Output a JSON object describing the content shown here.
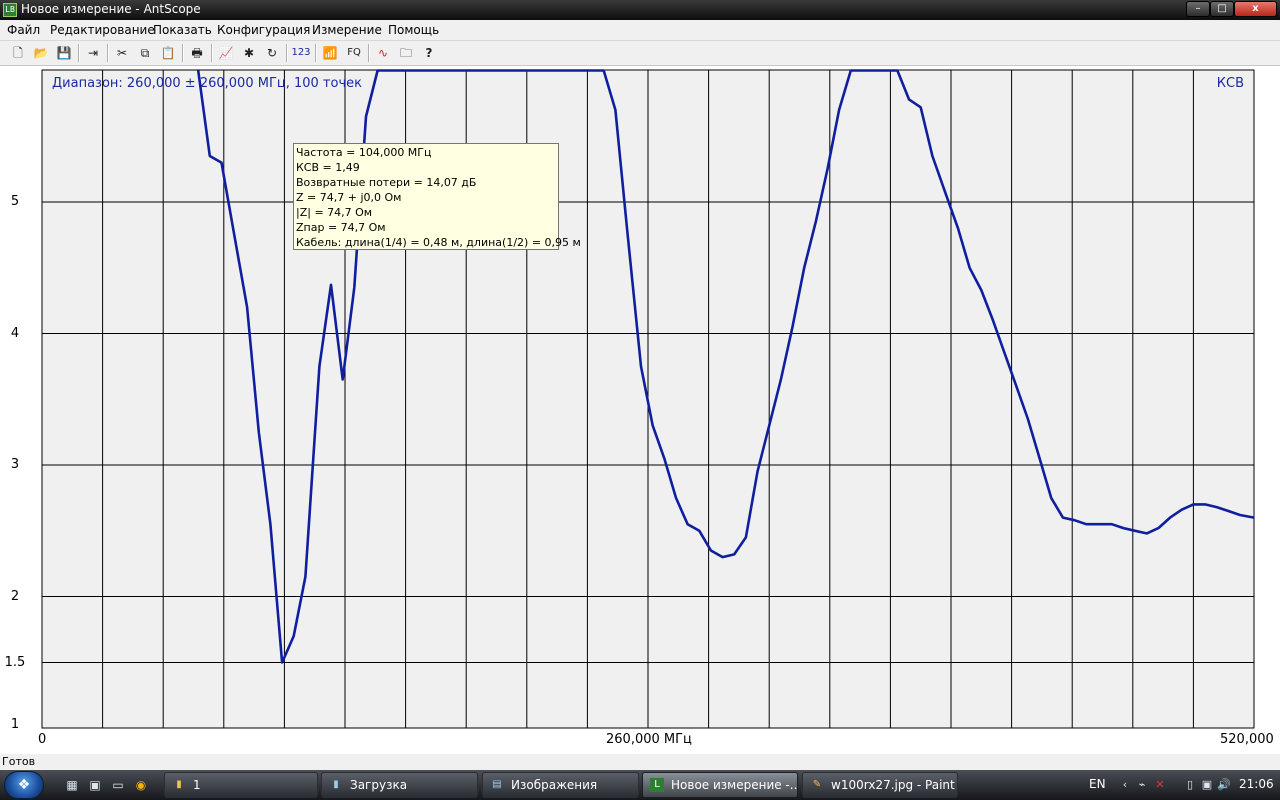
{
  "window": {
    "title": "Новое измерение - AntScope",
    "app_icon": "antscope-app-icon",
    "controls": {
      "minimize": "–",
      "maximize": "□",
      "close": "x"
    }
  },
  "menu": {
    "items": [
      "Файл",
      "Редактирование",
      "Показать",
      "Конфигурация",
      "Измерение",
      "Помощь"
    ]
  },
  "toolbar": {
    "buttons": [
      {
        "name": "new-icon",
        "glyph": "🗋"
      },
      {
        "name": "open-icon",
        "glyph": "📂"
      },
      {
        "name": "save-icon",
        "glyph": "💾"
      },
      {
        "name": "export-icon",
        "glyph": "⇥"
      },
      {
        "name": "cut-icon",
        "glyph": "✂"
      },
      {
        "name": "copy-icon",
        "glyph": "⧉"
      },
      {
        "name": "paste-icon",
        "glyph": "📋"
      },
      {
        "name": "print-icon",
        "glyph": "🖶"
      },
      {
        "name": "chart-icon",
        "glyph": "📈"
      },
      {
        "name": "markers-icon",
        "glyph": "✱"
      },
      {
        "name": "refresh-icon",
        "glyph": "↻"
      },
      {
        "name": "number-icon",
        "glyph": "123"
      },
      {
        "name": "antenna-icon",
        "glyph": "📶"
      },
      {
        "name": "frequency-icon",
        "glyph": "FQ"
      },
      {
        "name": "waves-icon",
        "glyph": "∿"
      },
      {
        "name": "open-folder-icon",
        "glyph": "🗀"
      },
      {
        "name": "help-icon",
        "glyph": "?"
      }
    ]
  },
  "chart_info": {
    "range_label": "Диапазон: 260,000 ± 260,000 МГц, 100 точек",
    "unit_label": "КСВ"
  },
  "chart_data": {
    "type": "line",
    "title": "",
    "xlabel": "",
    "ylabel": "КСВ",
    "x_tick_labels": [
      "0",
      "260,000 МГц",
      "520,000"
    ],
    "y_tick_labels": [
      "5",
      "4",
      "3",
      "2",
      "1.5",
      "1"
    ],
    "xlim": [
      0,
      520
    ],
    "grid": true,
    "series": [
      {
        "color": "#0f1f9e",
        "x": [
          67,
          72,
          77,
          82,
          88,
          93,
          98,
          103,
          108,
          113,
          119,
          124,
          129,
          134,
          139,
          144,
          149,
          154,
          160,
          165,
          170,
          175,
          181,
          185,
          191,
          196,
          201,
          206,
          211,
          216,
          221,
          226,
          231,
          236,
          241,
          246,
          251,
          257,
          262,
          267,
          272,
          277,
          282,
          287,
          292,
          297,
          302,
          307,
          312,
          317,
          322,
          327,
          332,
          337,
          342,
          347,
          352,
          357,
          362,
          367,
          372,
          377,
          382,
          388,
          393,
          398,
          403,
          408,
          413,
          418,
          423,
          428,
          433,
          438,
          443,
          448,
          453,
          459,
          464,
          469,
          474,
          479,
          484,
          489,
          494,
          499,
          504,
          509,
          514,
          520
        ],
        "y": [
          6.0,
          5.35,
          5.3,
          4.8,
          4.2,
          3.25,
          2.55,
          1.5,
          1.7,
          2.15,
          3.75,
          4.37,
          3.65,
          4.35,
          5.65,
          6.0,
          6.0,
          6.0,
          6.0,
          6.0,
          6.0,
          6.0,
          6.0,
          6.0,
          6.0,
          6.0,
          6.0,
          6.0,
          6.0,
          6.0,
          6.0,
          6.0,
          6.0,
          6.0,
          6.0,
          5.7,
          4.8,
          3.75,
          3.3,
          3.05,
          2.75,
          2.55,
          2.5,
          2.35,
          2.3,
          2.32,
          2.45,
          2.95,
          3.3,
          3.65,
          4.05,
          4.5,
          4.85,
          5.25,
          5.7,
          6.0,
          6.0,
          6.0,
          6.0,
          6.0,
          5.78,
          5.72,
          5.35,
          5.05,
          4.8,
          4.5,
          4.33,
          4.1,
          3.85,
          3.6,
          3.35,
          3.05,
          2.75,
          2.6,
          2.58,
          2.55,
          2.55,
          2.55,
          2.52,
          2.5,
          2.48,
          2.52,
          2.6,
          2.66,
          2.7,
          2.7,
          2.68,
          2.65,
          2.62,
          2.6
        ]
      }
    ]
  },
  "tooltip": {
    "lines": [
      "Частота = 104,000 МГц",
      "КСВ = 1,49",
      "Возвратные потери = 14,07 дБ",
      "Z = 74,7 + j0,0 Ом",
      "|Z| = 74,7 Ом",
      "Zпар = 74,7 Ом",
      "Кабель: длина(1/4) = 0,48 м, длина(1/2) = 0,95 м"
    ]
  },
  "status": {
    "text": "Готов"
  },
  "taskbar": {
    "tasks": [
      {
        "label": "1",
        "icon": "folder-icon"
      },
      {
        "label": "Загрузка",
        "icon": "folder-icon"
      },
      {
        "label": "Изображения",
        "icon": "folder-icon"
      },
      {
        "label": "Новое измерение -...",
        "icon": "antscope-icon",
        "active": true
      },
      {
        "label": "w100rx27.jpg - Paint",
        "icon": "paint-icon"
      }
    ],
    "language": "EN",
    "clock": "21:06"
  }
}
